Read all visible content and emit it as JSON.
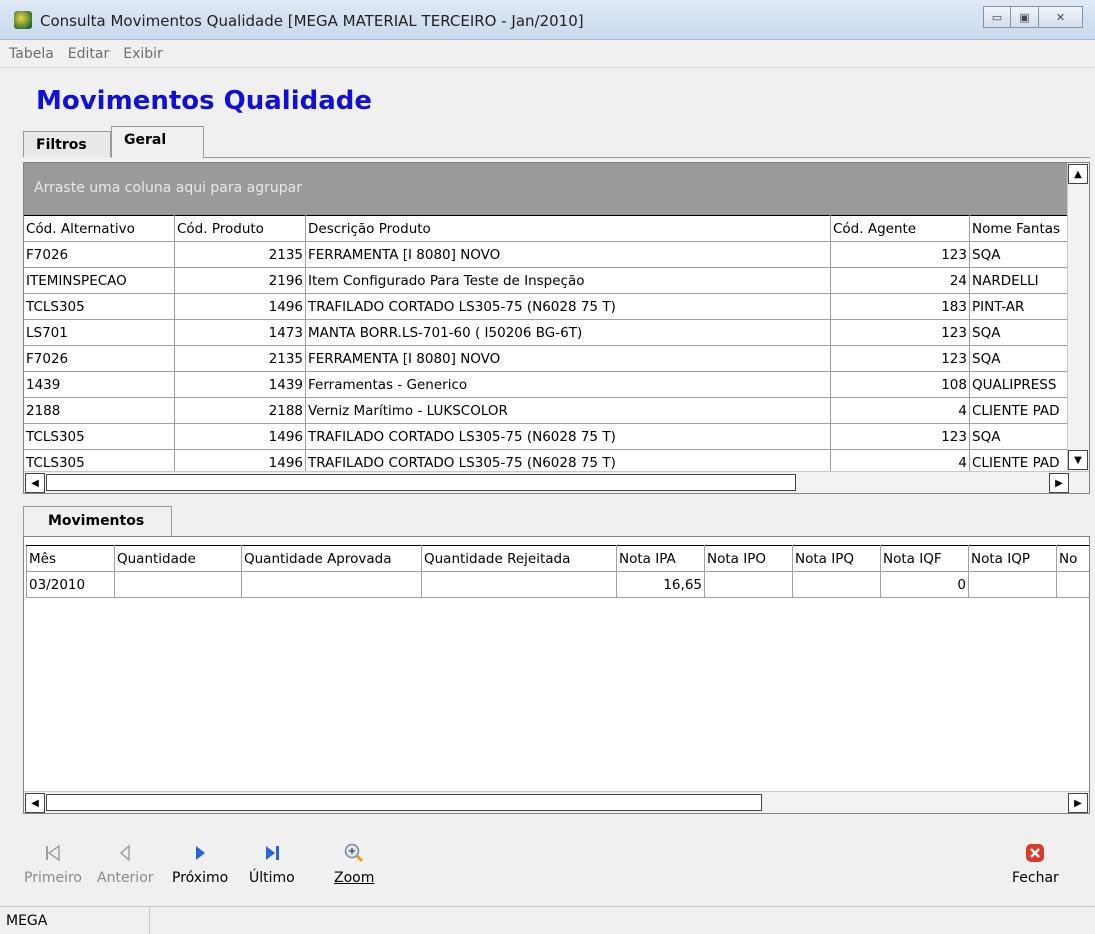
{
  "window": {
    "title": "Consulta Movimentos Qualidade [MEGA MATERIAL TERCEIRO - Jan/2010]",
    "min": "▭",
    "max": "▣",
    "close": "✕"
  },
  "menu": [
    "Tabela",
    "Editar",
    "Exibir"
  ],
  "page_title": "Movimentos Qualidade",
  "tabs": {
    "filtros": "Filtros",
    "geral": "Geral"
  },
  "grid": {
    "group_hint": "Arraste uma coluna aqui para agrupar",
    "columns": [
      "Cód. Alternativo",
      "Cód. Produto",
      "Descrição Produto",
      "Cód. Agente",
      "Nome Fantas"
    ],
    "rows": [
      [
        "F7026",
        "2135",
        "FERRAMENTA [I 8080] NOVO",
        "123",
        "SQA"
      ],
      [
        "ITEMINSPECAO",
        "2196",
        "Item Configurado Para Teste de Inspeção",
        "24",
        "NARDELLI"
      ],
      [
        "TCLS305",
        "1496",
        "TRAFILADO CORTADO LS305-75 (N6028 75 T)",
        "183",
        "PINT-AR"
      ],
      [
        "LS701",
        "1473",
        "MANTA BORR.LS-701-60 ( I50206 BG-6T)",
        "123",
        "SQA"
      ],
      [
        "F7026",
        "2135",
        "FERRAMENTA [I 8080] NOVO",
        "123",
        "SQA"
      ],
      [
        "1439",
        "1439",
        "Ferramentas - Generico",
        "108",
        "QUALIPRESS"
      ],
      [
        "2188",
        "2188",
        "Verniz Marítimo - LUKSCOLOR",
        "4",
        "CLIENTE PAD"
      ],
      [
        "TCLS305",
        "1496",
        "TRAFILADO CORTADO LS305-75 (N6028 75 T)",
        "123",
        "SQA"
      ],
      [
        "TCLS305",
        "1496",
        "TRAFILADO CORTADO LS305-75 (N6028 75 T)",
        "4",
        "CLIENTE PAD"
      ]
    ]
  },
  "movimentos": {
    "tab_label": "Movimentos",
    "columns": [
      "Mês",
      "Quantidade",
      "Quantidade Aprovada",
      "Quantidade Rejeitada",
      "Nota IPA",
      "Nota IPO",
      "Nota IPQ",
      "Nota IQF",
      "Nota IQP",
      "No"
    ],
    "rows": [
      [
        "03/2010",
        "",
        "",
        "",
        "16,65",
        "",
        "",
        "0",
        "",
        ""
      ]
    ]
  },
  "toolbar": {
    "primeiro": "Primeiro",
    "anterior": "Anterior",
    "proximo": "Próximo",
    "ultimo": "Último",
    "zoom": "Zoom",
    "fechar": "Fechar"
  },
  "status": {
    "company": "MEGA"
  },
  "colors": {
    "title_blue": "#1010d8",
    "group_bar": "#9a9a9a",
    "nav_blue": "#2b63d8",
    "close_red": "#d93a2b"
  }
}
